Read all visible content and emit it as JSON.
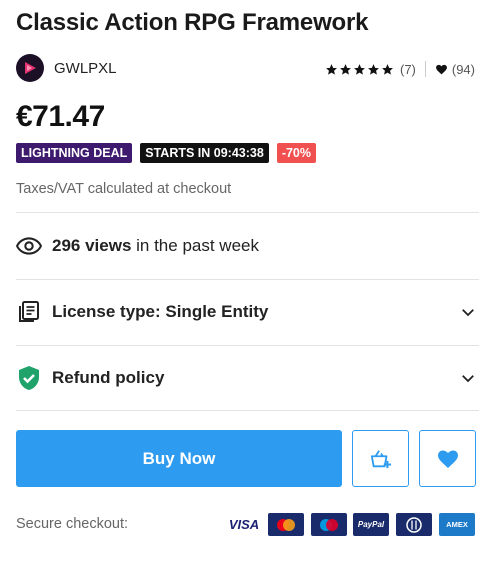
{
  "product": {
    "title": "Classic Action RPG Framework",
    "publisher": "GWLPXL",
    "publisher_logo_text": "GWLPXL",
    "rating_count": "(7)",
    "favorites_count": "(94)",
    "price": "€71.47"
  },
  "badges": {
    "deal": "LIGHTNING DEAL",
    "starts": "STARTS IN 09:43:38",
    "discount": "-70%"
  },
  "tax_note": "Taxes/VAT calculated at checkout",
  "views": {
    "count": "296 views",
    "suffix": " in the past week"
  },
  "license": {
    "label": "License type: Single Entity"
  },
  "refund": {
    "label": "Refund policy"
  },
  "actions": {
    "buy_label": "Buy Now"
  },
  "checkout": {
    "label": "Secure checkout:"
  },
  "payment_methods": [
    "VISA",
    "Mastercard",
    "Maestro",
    "PayPal",
    "Diners Club",
    "AMEX"
  ],
  "colors": {
    "accent": "#2d9bf0",
    "deal": "#3d1a6e",
    "discount": "#f05150",
    "shield": "#1fa36b"
  }
}
